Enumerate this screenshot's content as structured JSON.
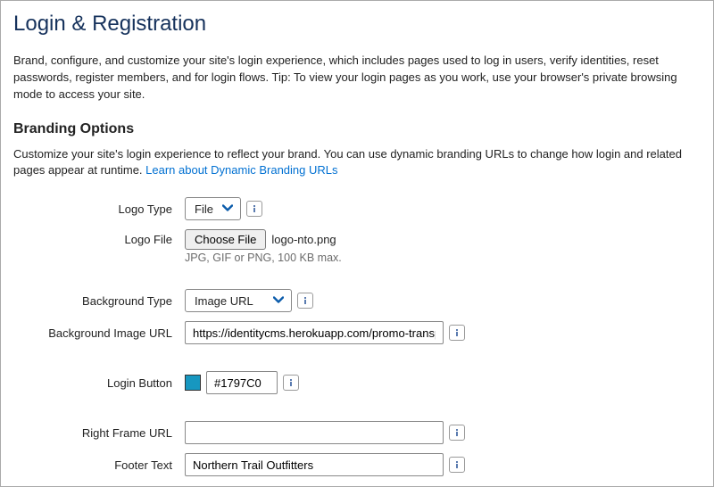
{
  "page": {
    "title": "Login & Registration",
    "intro": "Brand, configure, and customize your site's login experience, which includes pages used to log in users, verify identities, reset passwords, register members, and for login flows. Tip: To view your login pages as you work, use your browser's private browsing mode to access your site."
  },
  "branding": {
    "heading": "Branding Options",
    "desc_before_link": "Customize your site's login experience to reflect your brand. You can use dynamic branding URLs to change how login and related pages appear at runtime. ",
    "link_text": "Learn about Dynamic Branding URLs"
  },
  "fields": {
    "logo_type": {
      "label": "Logo Type",
      "value": "File"
    },
    "logo_file": {
      "label": "Logo File",
      "button": "Choose File",
      "filename": "logo-nto.png",
      "hint": "JPG, GIF or PNG, 100 KB max."
    },
    "background_type": {
      "label": "Background Type",
      "value": "Image URL"
    },
    "background_image_url": {
      "label": "Background Image URL",
      "value": "https://identitycms.herokuapp.com/promo-transp"
    },
    "login_button": {
      "label": "Login Button",
      "value": "#1797C0",
      "swatch": "#1797C0"
    },
    "right_frame_url": {
      "label": "Right Frame URL",
      "value": ""
    },
    "footer_text": {
      "label": "Footer Text",
      "value": "Northern Trail Outfitters"
    }
  }
}
